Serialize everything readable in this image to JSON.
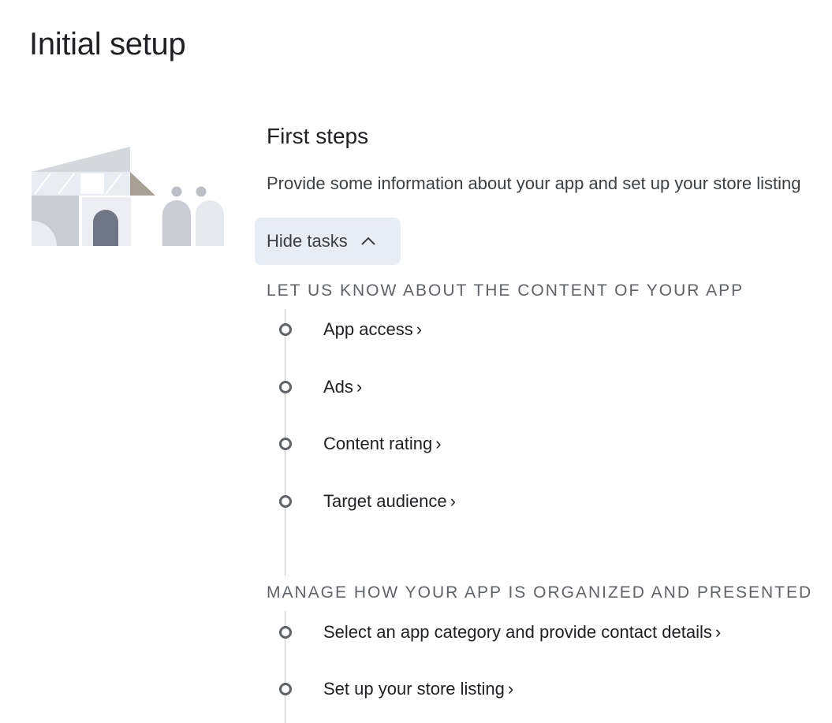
{
  "page": {
    "title": "Initial setup"
  },
  "card": {
    "title": "First steps",
    "description": "Provide some information about your app and set up your store listing",
    "hide_tasks_label": "Hide tasks",
    "hide_tasks_icon": "chevron-up-icon"
  },
  "sections": [
    {
      "heading": "LET US KNOW ABOUT THE CONTENT OF YOUR APP",
      "tasks": [
        {
          "label": "App access",
          "arrow": "›"
        },
        {
          "label": "Ads",
          "arrow": "›"
        },
        {
          "label": "Content rating",
          "arrow": "›"
        },
        {
          "label": "Target audience",
          "arrow": "›"
        }
      ]
    },
    {
      "heading": "MANAGE HOW YOUR APP IS ORGANIZED AND PRESENTED",
      "tasks": [
        {
          "label": "Select an app category and provide contact details",
          "arrow": "›"
        },
        {
          "label": "Set up your store listing",
          "arrow": "›"
        }
      ]
    }
  ],
  "colors": {
    "text_primary": "#202124",
    "text_secondary": "#5f6368",
    "button_bg": "#e8ecf4",
    "timeline": "#c7c9cc"
  }
}
